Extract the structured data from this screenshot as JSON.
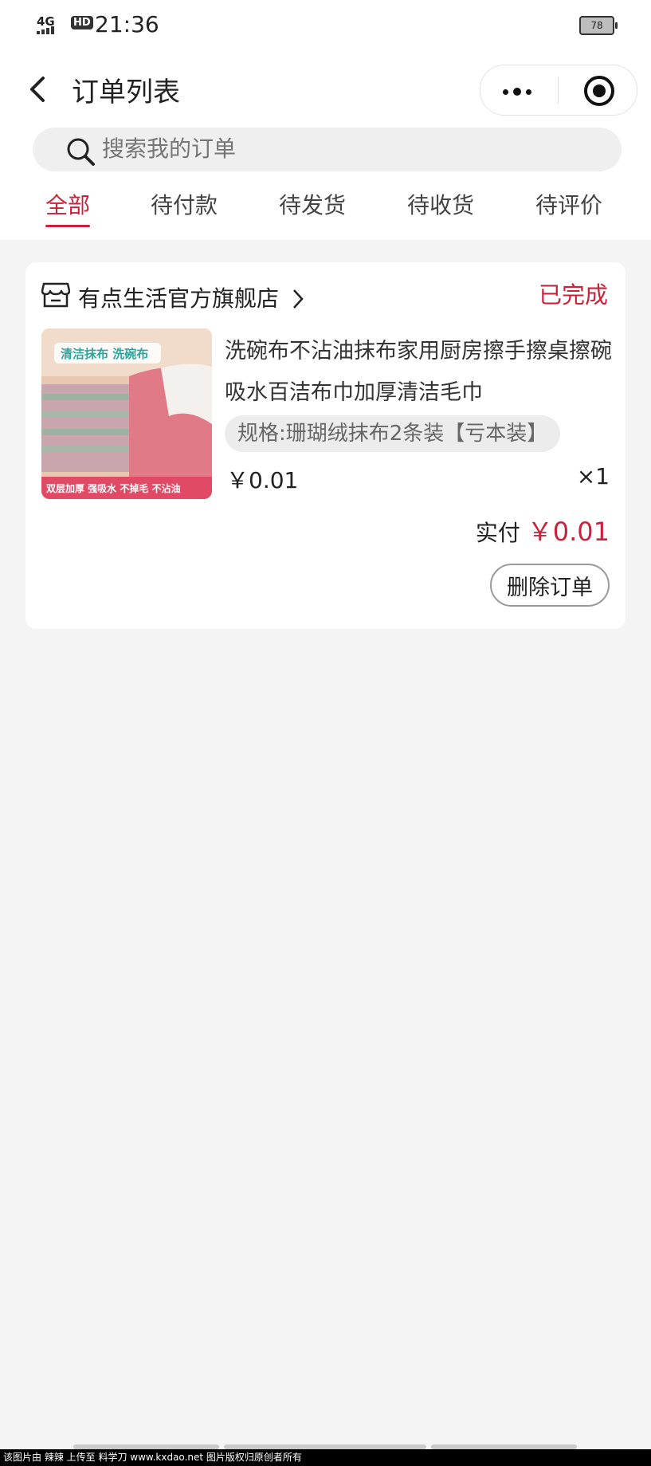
{
  "status_bar": {
    "network": "4G",
    "hd": "HD",
    "time": "21:36",
    "battery": "78"
  },
  "nav": {
    "title": "订单列表"
  },
  "search": {
    "placeholder": "搜索我的订单"
  },
  "tabs": [
    {
      "label": "全部",
      "active": true
    },
    {
      "label": "待付款",
      "active": false
    },
    {
      "label": "待发货",
      "active": false
    },
    {
      "label": "待收货",
      "active": false
    },
    {
      "label": "待评价",
      "active": false
    }
  ],
  "order": {
    "shop_name": "有点生活官方旗舰店",
    "status": "已完成",
    "product_title": "洗碗布不沾油抹布家用厨房擦手擦桌擦碗吸水百洁布巾加厚清洁毛巾",
    "spec": "规格:珊瑚绒抹布2条装【亏本装】",
    "price": "￥0.01",
    "quantity": "×1",
    "paid_label": "实付",
    "paid_amount": "￥0.01",
    "delete_label": "删除订单",
    "thumb_tag": "清洁抹布 洗碗布",
    "thumb_caption": "双层加厚 强吸水 不掉毛 不沾油"
  },
  "watermark": "该图片由 辣辣 上传至 料学刀 www.kxdao.net 图片版权归原创者所有",
  "colors": {
    "accent": "#c8233a",
    "background": "#f4f4f4"
  }
}
